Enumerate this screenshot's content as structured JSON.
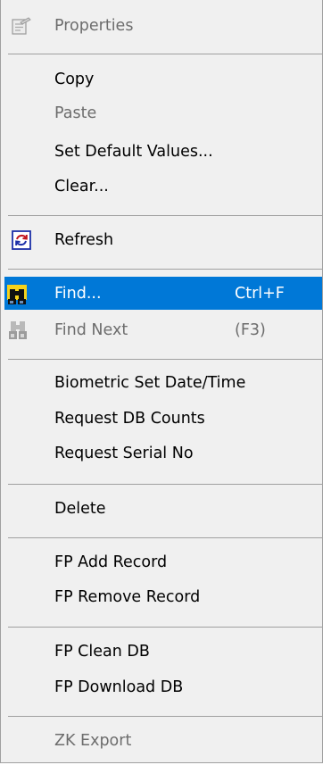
{
  "menu": {
    "items": [
      {
        "label": "Properties",
        "icon": "properties-icon",
        "enabled": false
      },
      {
        "label": "Copy",
        "enabled": true
      },
      {
        "label": "Paste",
        "enabled": false
      },
      {
        "label": "Set Default Values...",
        "enabled": true
      },
      {
        "label": "Clear...",
        "enabled": true
      },
      {
        "label": "Refresh",
        "icon": "refresh-icon",
        "enabled": true
      },
      {
        "label": "Find...",
        "shortcut": "Ctrl+F",
        "icon": "binoculars-icon",
        "enabled": true,
        "highlighted": true
      },
      {
        "label": "Find Next",
        "shortcut": "(F3)",
        "icon": "binoculars-icon",
        "enabled": false
      },
      {
        "label": "Biometric Set Date/Time",
        "enabled": true
      },
      {
        "label": "Request DB Counts",
        "enabled": true
      },
      {
        "label": "Request Serial No",
        "enabled": true
      },
      {
        "label": "Delete",
        "enabled": true
      },
      {
        "label": "FP Add Record",
        "enabled": true
      },
      {
        "label": "FP Remove Record",
        "enabled": true
      },
      {
        "label": "FP Clean DB",
        "enabled": true
      },
      {
        "label": "FP Download DB",
        "enabled": true
      },
      {
        "label": "ZK Export",
        "enabled": false
      }
    ],
    "colors": {
      "highlight": "#0078d7",
      "disabled_text": "#6d6d6d",
      "background": "#f0f0f0"
    }
  }
}
